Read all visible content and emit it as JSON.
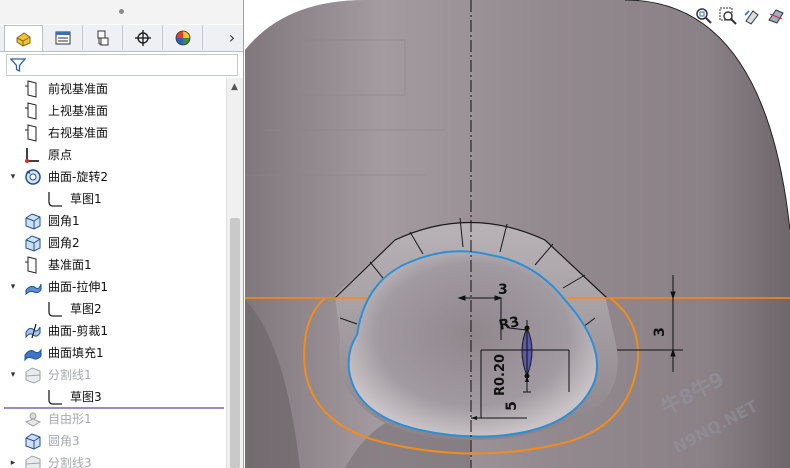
{
  "tabs": [
    {
      "name": "feature-manager",
      "icon": "feature-manager-icon"
    },
    {
      "name": "property-manager",
      "icon": "property-manager-icon"
    },
    {
      "name": "configuration-manager",
      "icon": "configuration-manager-icon"
    },
    {
      "name": "dimxpert-manager",
      "icon": "dimxpert-icon"
    },
    {
      "name": "display-manager",
      "icon": "display-manager-icon"
    }
  ],
  "tab_more": "›",
  "tree": [
    {
      "label": "前视基准面",
      "icon": "plane-icon",
      "indent": 0,
      "expander": "",
      "dim": false
    },
    {
      "label": "上视基准面",
      "icon": "plane-icon",
      "indent": 0,
      "expander": "",
      "dim": false
    },
    {
      "label": "右视基准面",
      "icon": "plane-icon",
      "indent": 0,
      "expander": "",
      "dim": false
    },
    {
      "label": "原点",
      "icon": "origin-icon",
      "indent": 0,
      "expander": "",
      "dim": false
    },
    {
      "label": "曲面-旋转2",
      "icon": "surface-revolve-icon",
      "indent": 0,
      "expander": "▾",
      "dim": false
    },
    {
      "label": "草图1",
      "icon": "sketch-icon",
      "indent": 1,
      "expander": "",
      "dim": false
    },
    {
      "label": "圆角1",
      "icon": "fillet-icon",
      "indent": 0,
      "expander": "",
      "dim": false
    },
    {
      "label": "圆角2",
      "icon": "fillet-icon",
      "indent": 0,
      "expander": "",
      "dim": false
    },
    {
      "label": "基准面1",
      "icon": "plane-icon",
      "indent": 0,
      "expander": "",
      "dim": false
    },
    {
      "label": "曲面-拉伸1",
      "icon": "surface-extrude-icon",
      "indent": 0,
      "expander": "▾",
      "dim": false
    },
    {
      "label": "草图2",
      "icon": "sketch-icon",
      "indent": 1,
      "expander": "",
      "dim": false
    },
    {
      "label": "曲面-剪裁1",
      "icon": "surface-trim-icon",
      "indent": 0,
      "expander": "",
      "dim": false
    },
    {
      "label": "曲面填充1",
      "icon": "surface-fill-icon",
      "indent": 0,
      "expander": "",
      "dim": false
    },
    {
      "label": "分割线1",
      "icon": "split-line-icon",
      "indent": 0,
      "expander": "▾",
      "dim": true
    },
    {
      "label": "草图3",
      "icon": "sketch-icon",
      "indent": 1,
      "expander": "",
      "dim": false
    },
    {
      "label": "自由形1",
      "icon": "freeform-icon",
      "indent": 0,
      "expander": "",
      "dim": true
    },
    {
      "label": "圆角3",
      "icon": "fillet-icon",
      "indent": 0,
      "expander": "",
      "dim": true
    },
    {
      "label": "分割线3",
      "icon": "split-line-icon",
      "indent": 0,
      "expander": "▸",
      "dim": true
    }
  ],
  "dimensions": {
    "width": "3",
    "height": "3",
    "radius": "R3",
    "radius_small": "R0.20",
    "offset": "5"
  },
  "watermark": "牛8牛9",
  "watermark2": "N9NQ.NET",
  "colors": {
    "orange_line": "#f28c1c",
    "blue_line": "#2b8fd6",
    "surface": "#9b9196"
  }
}
